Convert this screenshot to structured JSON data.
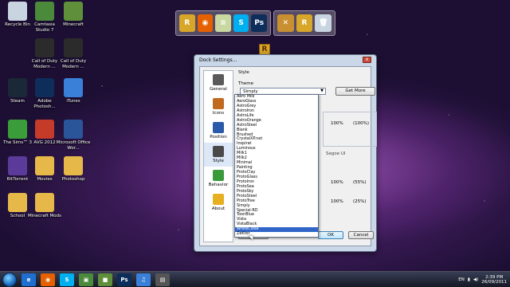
{
  "desktop_icons": [
    {
      "id": "recycle-bin",
      "label": "Recycle Bin",
      "icon": "recycle-bin-icon",
      "color": "#c8d4e0"
    },
    {
      "id": "camtasia",
      "label": "Camtasia Studio 7",
      "icon": "camtasia-icon",
      "color": "#4a8a3a"
    },
    {
      "id": "minecraft",
      "label": "Minecraft",
      "icon": "minecraft-icon",
      "color": "#5f8f3a"
    },
    {
      "id": "cod1",
      "label": "Call of Duty Modern ...",
      "icon": "call-of-duty-icon",
      "color": "#2b2b2b"
    },
    {
      "id": "cod2",
      "label": "Call of Duty Modern ...",
      "icon": "call-of-duty-2-icon",
      "color": "#2b2b2b"
    },
    {
      "id": "steam",
      "label": "Steam",
      "icon": "steam-icon",
      "color": "#1b2838"
    },
    {
      "id": "photoshop-desk",
      "label": "Adobe Photosh...",
      "icon": "photoshop-icon",
      "color": "#0d2d5a"
    },
    {
      "id": "itunes",
      "label": "iTunes",
      "icon": "itunes-icon",
      "color": "#3a7fd8"
    },
    {
      "id": "sims",
      "label": "The Sims™ 3",
      "icon": "sims-icon",
      "color": "#3a9d3a"
    },
    {
      "id": "xvid",
      "label": "AVG 2012",
      "icon": "avg-icon",
      "color": "#c43b2a"
    },
    {
      "id": "word",
      "label": "Microsoft Office Wor...",
      "icon": "word-icon",
      "color": "#2a5699"
    },
    {
      "id": "bittorrent",
      "label": "BitTorrent",
      "icon": "bittorrent-icon",
      "color": "#5b3b99"
    },
    {
      "id": "movies",
      "label": "Movies",
      "icon": "folder-icon",
      "color": "#e6b84a"
    },
    {
      "id": "photoshop-folder",
      "label": "Photoshop",
      "icon": "folder-icon",
      "color": "#e6b84a"
    },
    {
      "id": "school",
      "label": "School",
      "icon": "folder-icon",
      "color": "#e6b84a"
    },
    {
      "id": "mc-mods",
      "label": "Minecraft Mods",
      "icon": "folder-icon",
      "color": "#e6b84a"
    }
  ],
  "dock": {
    "group1": [
      {
        "icon": "dock-stack-icon",
        "color": "#d8a628",
        "glyph": "R"
      },
      {
        "icon": "firefox-icon",
        "color": "#e66000",
        "glyph": "◉"
      },
      {
        "icon": "notes-icon",
        "color": "#c8d8a0",
        "glyph": "≡"
      },
      {
        "icon": "skype-icon",
        "color": "#00aff0",
        "glyph": "S"
      },
      {
        "icon": "photoshop-icon",
        "color": "#0d2d5a",
        "glyph": "Ps"
      }
    ],
    "group2": [
      {
        "icon": "tools-icon",
        "color": "#c89030",
        "glyph": "✕"
      },
      {
        "icon": "rocketdock-icon",
        "color": "#d8a628",
        "glyph": "R"
      },
      {
        "icon": "recycle-bin-icon",
        "color": "#c8d4e0",
        "glyph": "🗑"
      }
    ],
    "floating_label": "R"
  },
  "dialog": {
    "title": "Dock Settings...",
    "close_label": "x",
    "sidebar": [
      {
        "label": "General",
        "icon": "general-icon",
        "color": "#5a5a5a"
      },
      {
        "label": "Icons",
        "icon": "icons-icon",
        "color": "#c06a20"
      },
      {
        "label": "Position",
        "icon": "position-icon",
        "color": "#2a5aa8"
      },
      {
        "label": "Style",
        "icon": "style-icon",
        "color": "#4a4a4a"
      },
      {
        "label": "Behavior",
        "icon": "behavior-icon",
        "color": "#3a9a3a"
      },
      {
        "label": "About",
        "icon": "about-icon",
        "color": "#e6b020"
      }
    ],
    "section_label": "Style",
    "theme_label": "Theme",
    "theme_value": "Simply",
    "get_more_label": "Get More",
    "pct_1": "100%",
    "pct_1b": "(100%)",
    "pct_2": "100%",
    "pct_2b": "(55%)",
    "pct_3": "100%",
    "pct_3b": "(25%)",
    "ghost_text": "Segoe UI",
    "defaults_label": "Defaults",
    "ok_label": "OK",
    "cancel_label": "Cancel",
    "theme_options": [
      "Aero Milk",
      "AeroGlass",
      "AstroGrey",
      "AstroIron",
      "AstroLife",
      "AstroOrange",
      "AstroSteel",
      "Blank",
      "Brushed",
      "CrystalXP.net",
      "Inspirat",
      "Luminous",
      "Milk1",
      "Milk2",
      "Minimal",
      "Painting",
      "ProtoClay",
      "ProtoGlass",
      "ProtoIron",
      "ProtoSea",
      "ProtoSky",
      "ProtoSteel",
      "ProtoTree",
      "Simply",
      "Special-RD",
      "ToonBlue",
      "Vista",
      "VistaBlack",
      "WhiteClose",
      "ZeKtor"
    ],
    "selected_option_index": 28
  },
  "taskbar": {
    "items": [
      {
        "icon": "ie-icon",
        "color": "#1e6fd0",
        "glyph": "e"
      },
      {
        "icon": "firefox-icon",
        "color": "#e66000",
        "glyph": "◉"
      },
      {
        "icon": "skype-icon",
        "color": "#00aff0",
        "glyph": "S"
      },
      {
        "icon": "camtasia-icon",
        "color": "#4a8a3a",
        "glyph": "▣"
      },
      {
        "icon": "minecraft-icon",
        "color": "#5f8f3a",
        "glyph": "■"
      },
      {
        "icon": "photoshop-icon",
        "color": "#0d2d5a",
        "glyph": "Ps"
      },
      {
        "icon": "itunes-icon",
        "color": "#3a7fd8",
        "glyph": "♫"
      },
      {
        "icon": "rocketdock-icon",
        "color": "#555555",
        "glyph": "▤"
      }
    ],
    "lang": "EN",
    "time": "2:39 PM",
    "date": "26/09/2011"
  }
}
